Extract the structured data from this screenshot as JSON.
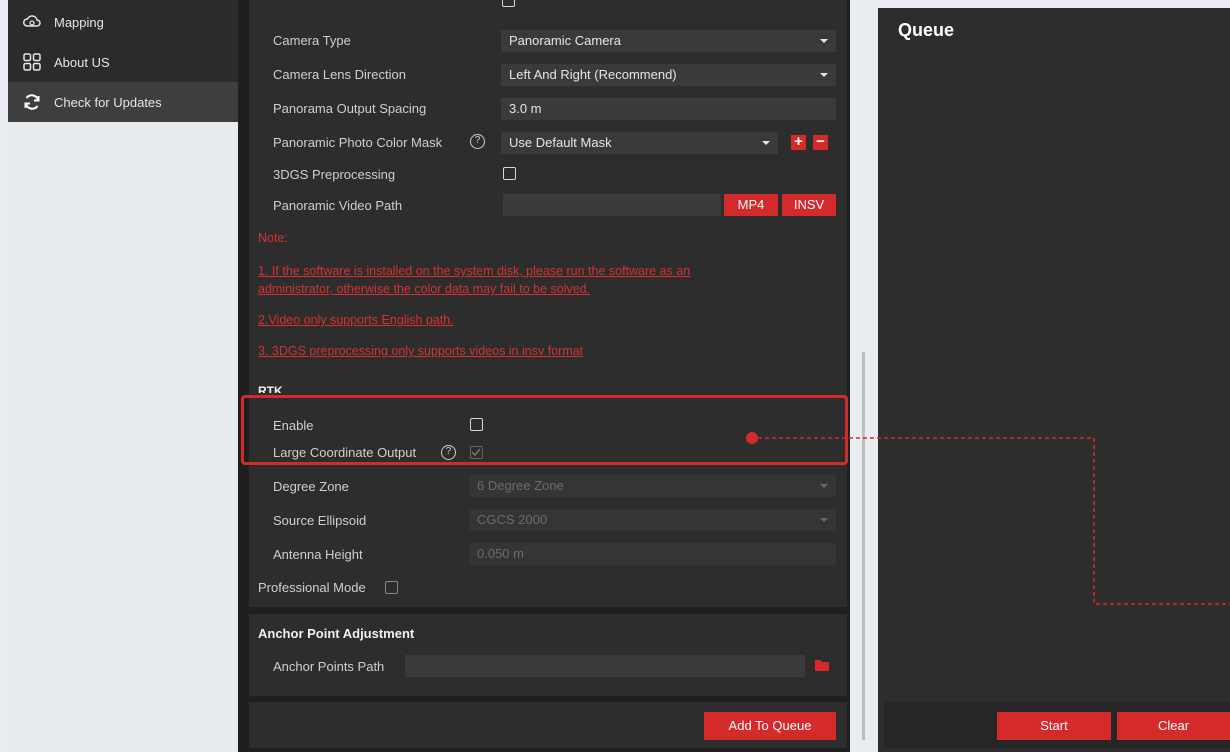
{
  "sidebar": {
    "items": [
      {
        "label": "Mapping",
        "icon": "cloud-icon"
      },
      {
        "label": "About US",
        "icon": "grid-icon"
      },
      {
        "label": "Check for Updates",
        "icon": "refresh-icon"
      }
    ]
  },
  "settings": {
    "camera_type_label": "Camera Type",
    "camera_type_value": "Panoramic Camera",
    "lens_direction_label": "Camera Lens Direction",
    "lens_direction_value": "Left And Right (Recommend)",
    "output_spacing_label": "Panorama Output Spacing",
    "output_spacing_value": "3.0 m",
    "color_mask_label": "Panoramic Photo Color Mask",
    "color_mask_value": "Use Default Mask",
    "preprocessing_label": "3DGS Preprocessing",
    "video_path_label": "Panoramic Video Path",
    "mp4_label": "MP4",
    "insv_label": "INSV",
    "help_glyph": "?",
    "add_glyph": "+",
    "remove_glyph": "−"
  },
  "notes": {
    "title": "Note:",
    "line1a": "1. If the software is installed on the system disk, please run the software as an",
    "line1b": "administrator, otherwise the color data may fail to be solved.",
    "line2": "2.Video only supports English path.",
    "line3": "3. 3DGS preprocessing only supports videos in insv format"
  },
  "rtk": {
    "title": "RTK",
    "enable_label": "Enable",
    "large_coord_label": "Large Coordinate Output",
    "degree_zone_label": "Degree Zone",
    "degree_zone_value": "6 Degree Zone",
    "ellipsoid_label": "Source Ellipsoid",
    "ellipsoid_value": "CGCS 2000",
    "antenna_label": "Antenna Height",
    "antenna_value": "0.050 m"
  },
  "professional_mode_label": "Professional Mode",
  "anchor": {
    "title": "Anchor Point Adjustment",
    "path_label": "Anchor Points Path"
  },
  "add_to_queue_label": "Add To Queue",
  "queue": {
    "title": "Queue",
    "start_label": "Start",
    "clear_label": "Clear"
  },
  "colors": {
    "accent": "#d42a2a",
    "panel": "#2d2d2d",
    "background": "#1f1f1f"
  }
}
